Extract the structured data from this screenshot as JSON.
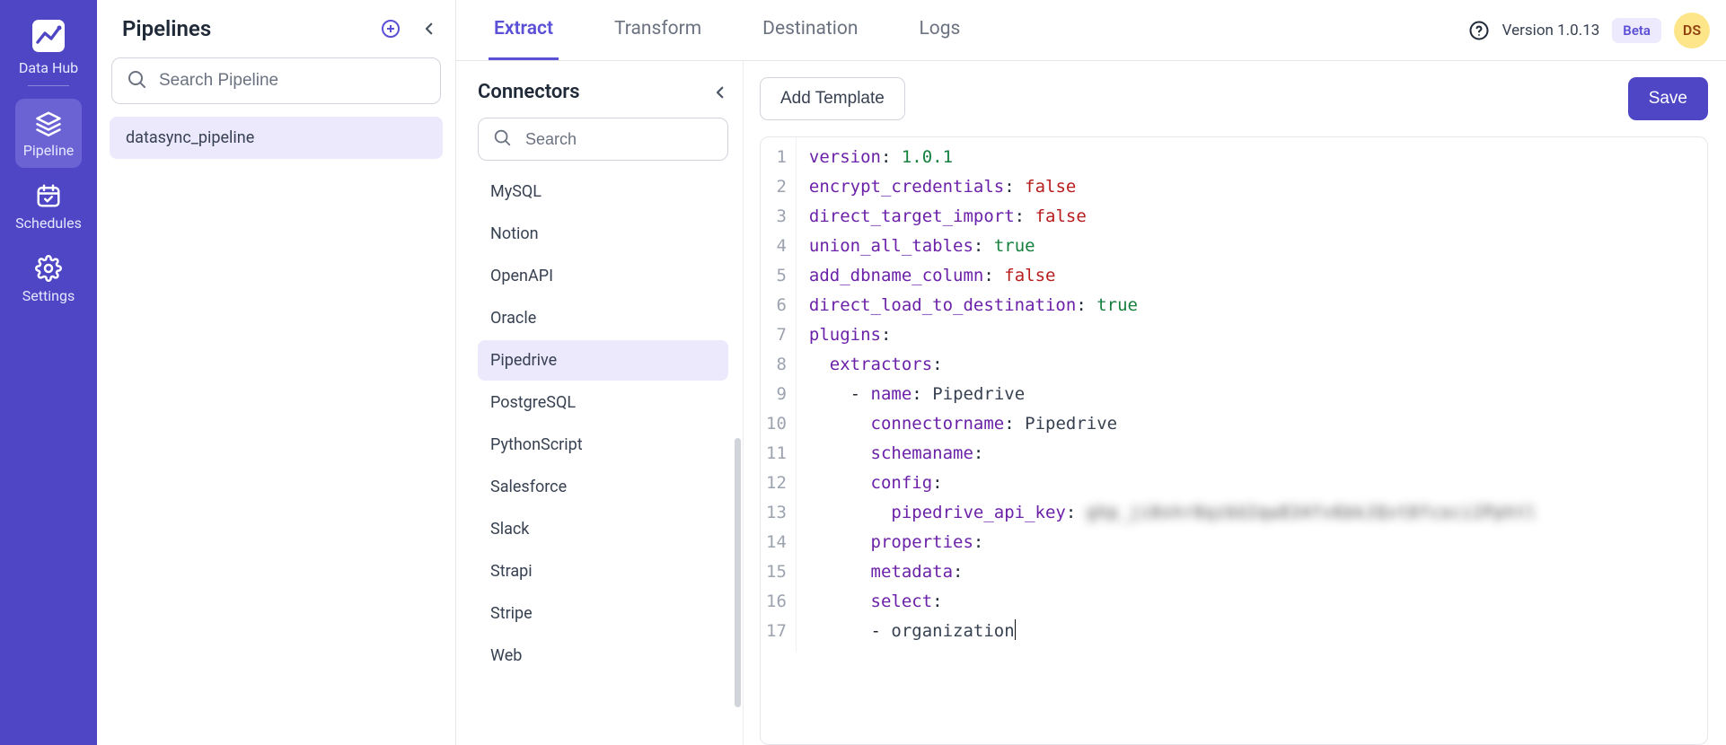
{
  "rail": {
    "brand": "Data Hub",
    "items": [
      {
        "key": "pipeline",
        "label": "Pipeline",
        "active": true
      },
      {
        "key": "schedules",
        "label": "Schedules",
        "active": false
      },
      {
        "key": "settings",
        "label": "Settings",
        "active": false
      }
    ]
  },
  "pipelines": {
    "title": "Pipelines",
    "search_placeholder": "Search Pipeline",
    "items": [
      {
        "name": "datasync_pipeline",
        "active": true
      }
    ]
  },
  "tabs": [
    {
      "key": "extract",
      "label": "Extract",
      "active": true
    },
    {
      "key": "transform",
      "label": "Transform",
      "active": false
    },
    {
      "key": "destination",
      "label": "Destination",
      "active": false
    },
    {
      "key": "logs",
      "label": "Logs",
      "active": false
    }
  ],
  "header": {
    "version": "Version 1.0.13",
    "beta": "Beta",
    "avatar_initials": "DS"
  },
  "connectors": {
    "title": "Connectors",
    "search_placeholder": "Search",
    "items": [
      "MySQL",
      "Notion",
      "OpenAPI",
      "Oracle",
      "Pipedrive",
      "PostgreSQL",
      "PythonScript",
      "Salesforce",
      "Slack",
      "Strapi",
      "Stripe",
      "Web"
    ],
    "active": "Pipedrive"
  },
  "editor": {
    "add_template_label": "Add Template",
    "save_label": "Save",
    "yaml": {
      "version": "1.0.1",
      "encrypt_credentials": false,
      "direct_target_import": false,
      "union_all_tables": true,
      "add_dbname_column": false,
      "direct_load_to_destination": true,
      "plugins": {
        "extractors": [
          {
            "name": "Pipedrive",
            "connectorname": "Pipedrive",
            "schemaname": "",
            "config": {
              "pipedrive_api_key": "ghp_ji0xhr8qzbU2qw834fv6bkJQvt8fcoci2Pphtl"
            },
            "properties": null,
            "metadata": null,
            "select": [
              "organization"
            ]
          }
        ]
      }
    },
    "yaml_lines": [
      {
        "n": 1,
        "indent": 0,
        "key": "version",
        "val": "1.0.1",
        "valClass": "tok-num"
      },
      {
        "n": 2,
        "indent": 0,
        "key": "encrypt_credentials",
        "val": "false",
        "valClass": "tok-bool-f"
      },
      {
        "n": 3,
        "indent": 0,
        "key": "direct_target_import",
        "val": "false",
        "valClass": "tok-bool-f"
      },
      {
        "n": 4,
        "indent": 0,
        "key": "union_all_tables",
        "val": "true",
        "valClass": "tok-bool-t"
      },
      {
        "n": 5,
        "indent": 0,
        "key": "add_dbname_column",
        "val": "false",
        "valClass": "tok-bool-f"
      },
      {
        "n": 6,
        "indent": 0,
        "key": "direct_load_to_destination",
        "val": "true",
        "valClass": "tok-bool-t"
      },
      {
        "n": 7,
        "indent": 0,
        "key": "plugins",
        "val": "",
        "valClass": ""
      },
      {
        "n": 8,
        "indent": 2,
        "key": "extractors",
        "val": "",
        "valClass": ""
      },
      {
        "n": 9,
        "indent": 4,
        "dash": true,
        "key": "name",
        "val": "Pipedrive",
        "valClass": "tok-plain"
      },
      {
        "n": 10,
        "indent": 6,
        "key": "connectorname",
        "val": "Pipedrive",
        "valClass": "tok-plain"
      },
      {
        "n": 11,
        "indent": 6,
        "key": "schemaname",
        "val": "",
        "valClass": ""
      },
      {
        "n": 12,
        "indent": 6,
        "key": "config",
        "val": "",
        "valClass": ""
      },
      {
        "n": 13,
        "indent": 8,
        "key": "pipedrive_api_key",
        "val": "ghp_ji0xhr8qzbU2qw834fv6bkJQvt8fcoci2Pphtl",
        "valClass": "tok-blur"
      },
      {
        "n": 14,
        "indent": 6,
        "key": "properties",
        "val": "",
        "valClass": ""
      },
      {
        "n": 15,
        "indent": 6,
        "key": "metadata",
        "val": "",
        "valClass": ""
      },
      {
        "n": 16,
        "indent": 6,
        "key": "select",
        "val": "",
        "valClass": ""
      },
      {
        "n": 17,
        "indent": 6,
        "dash": true,
        "plain": "organization",
        "caret": true
      }
    ]
  }
}
